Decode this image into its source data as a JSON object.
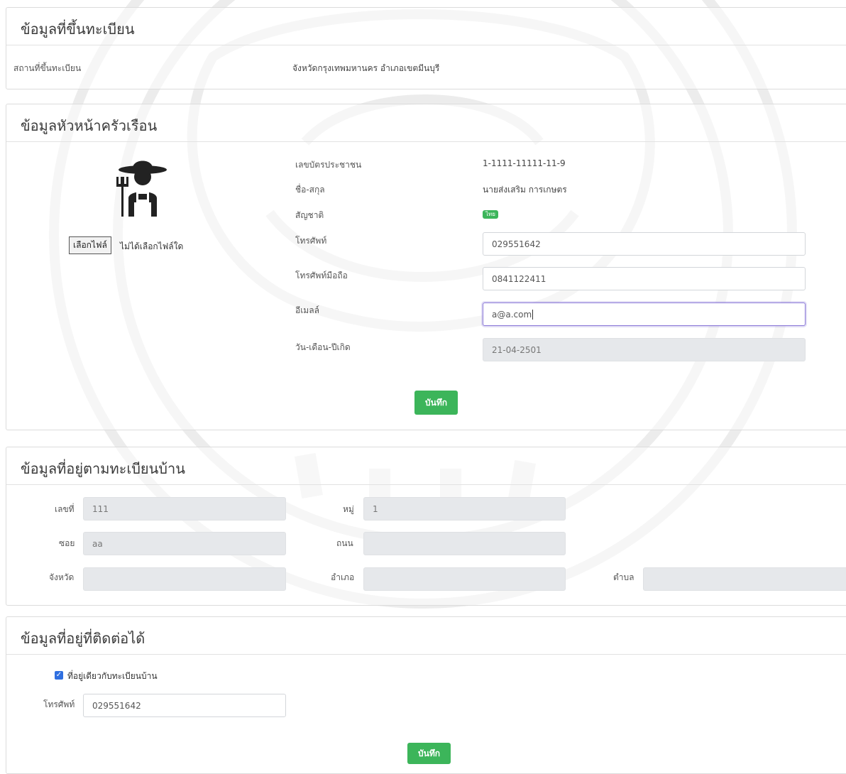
{
  "registration": {
    "title": "ข้อมูลที่ขึ้นทะเบียน",
    "place_label": "สถานที่ขึ้นทะเบียน",
    "place_value": "จังหวัดกรุงเทพมหานคร อำเภอเขตมีนบุรี"
  },
  "head": {
    "title": "ข้อมูลหัวหน้าครัวเรือน",
    "file_button": "เลือกไฟล์",
    "file_status": "ไม่ได้เลือกไฟล์ใด",
    "id_label": "เลขบัตรประชาชน",
    "id_value": "1-1111-11111-11-9",
    "name_label": "ชื่อ-สกุล",
    "name_value": "นายส่งเสริม การเกษตร",
    "nationality_label": "สัญชาติ",
    "nationality_value": "ไทย",
    "phone_label": "โทรศัพท์",
    "phone_value": "029551642",
    "mobile_label": "โทรศัพท์มือถือ",
    "mobile_value": "0841122411",
    "email_label": "อีเมลล์",
    "email_value": "a@a.com",
    "dob_label": "วัน-เดือน-ปีเกิด",
    "dob_value": "21-04-2501",
    "save_label": "บันทึก"
  },
  "house_address": {
    "title": "ข้อมูลที่อยู่ตามทะเบียนบ้าน",
    "number_label": "เลขที่",
    "number_value": "111",
    "moo_label": "หมู่",
    "moo_value": "1",
    "soi_label": "ซอย",
    "soi_value": "aa",
    "road_label": "ถนน",
    "road_value": "",
    "province_label": "จังหวัด",
    "province_value": "",
    "amphoe_label": "อำเภอ",
    "amphoe_value": "",
    "tambon_label": "ตำบล",
    "tambon_value": ""
  },
  "contact_address": {
    "title": "ข้อมูลที่อยู่ที่ติดต่อได้",
    "same_address_label": "ที่อยู่เดียวกับทะเบียนบ้าน",
    "same_address_checked": true,
    "phone_label": "โทรศัพท์",
    "phone_value": "029551642",
    "save_label": "บันทึก"
  },
  "colors": {
    "save_button": "#3cb55a",
    "badge": "#3cb55a",
    "focus_border": "#8c7ad8",
    "readonly_bg": "#e6e8eb"
  }
}
